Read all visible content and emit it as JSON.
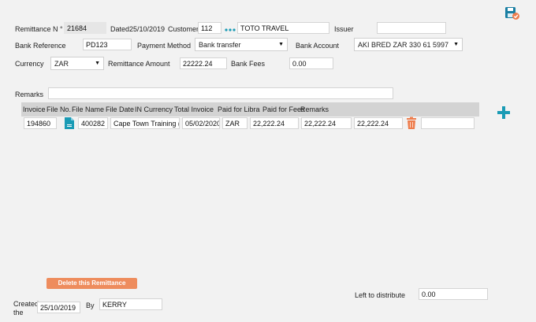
{
  "header": {
    "remittance_no_label": "Remittance N °",
    "remittance_no": "21684",
    "dated_label": "Dated",
    "dated": "25/10/2019",
    "customer_label": "Customer",
    "customer_code": "112",
    "customer_name": "TOTO TRAVEL",
    "issuer_label": "Issuer",
    "issuer": ""
  },
  "bank": {
    "reference_label": "Bank Reference",
    "reference": "PD123",
    "payment_method_label": "Payment Method",
    "payment_method": "Bank transfer",
    "account_label": "Bank Account",
    "account": "AKI BRED ZAR 330 61 5997"
  },
  "amounts": {
    "currency_label": "Currency",
    "currency": "ZAR",
    "remittance_amount_label": "Remittance Amount",
    "remittance_amount": "22222.24",
    "bank_fees_label": "Bank Fees",
    "bank_fees": "0.00"
  },
  "remarks": {
    "label": "Remarks",
    "value": ""
  },
  "table": {
    "headers": [
      "Invoice",
      "File No.",
      "File Name",
      "File Date",
      "IN Currency",
      "Total Invoice",
      "Paid for Libra",
      "Paid for Fees",
      "Remarks"
    ],
    "rows": [
      {
        "invoice": "194860",
        "file_no": "400282",
        "file_name": "Cape Town Training (C",
        "file_date": "05/02/2020",
        "currency": "ZAR",
        "total_invoice": "22,222.24",
        "paid_libra": "22,222.24",
        "paid_fees": "22,222.24",
        "remarks": ""
      }
    ]
  },
  "footer": {
    "delete_label": "Delete this Remittance",
    "created_label_1": "Created",
    "created_label_2": "the",
    "created_date": "25/10/2019",
    "by_label": "By",
    "by": "KERRY",
    "left_label": "Left to distribute",
    "left_value": "0.00"
  },
  "icons": {
    "save": "save-icon",
    "add": "plus-icon",
    "delete_row": "trash-icon",
    "file": "document-icon",
    "lookup": "dots-icon"
  },
  "colors": {
    "accent": "#1a9bb5",
    "danger": "#ee8c5d"
  }
}
